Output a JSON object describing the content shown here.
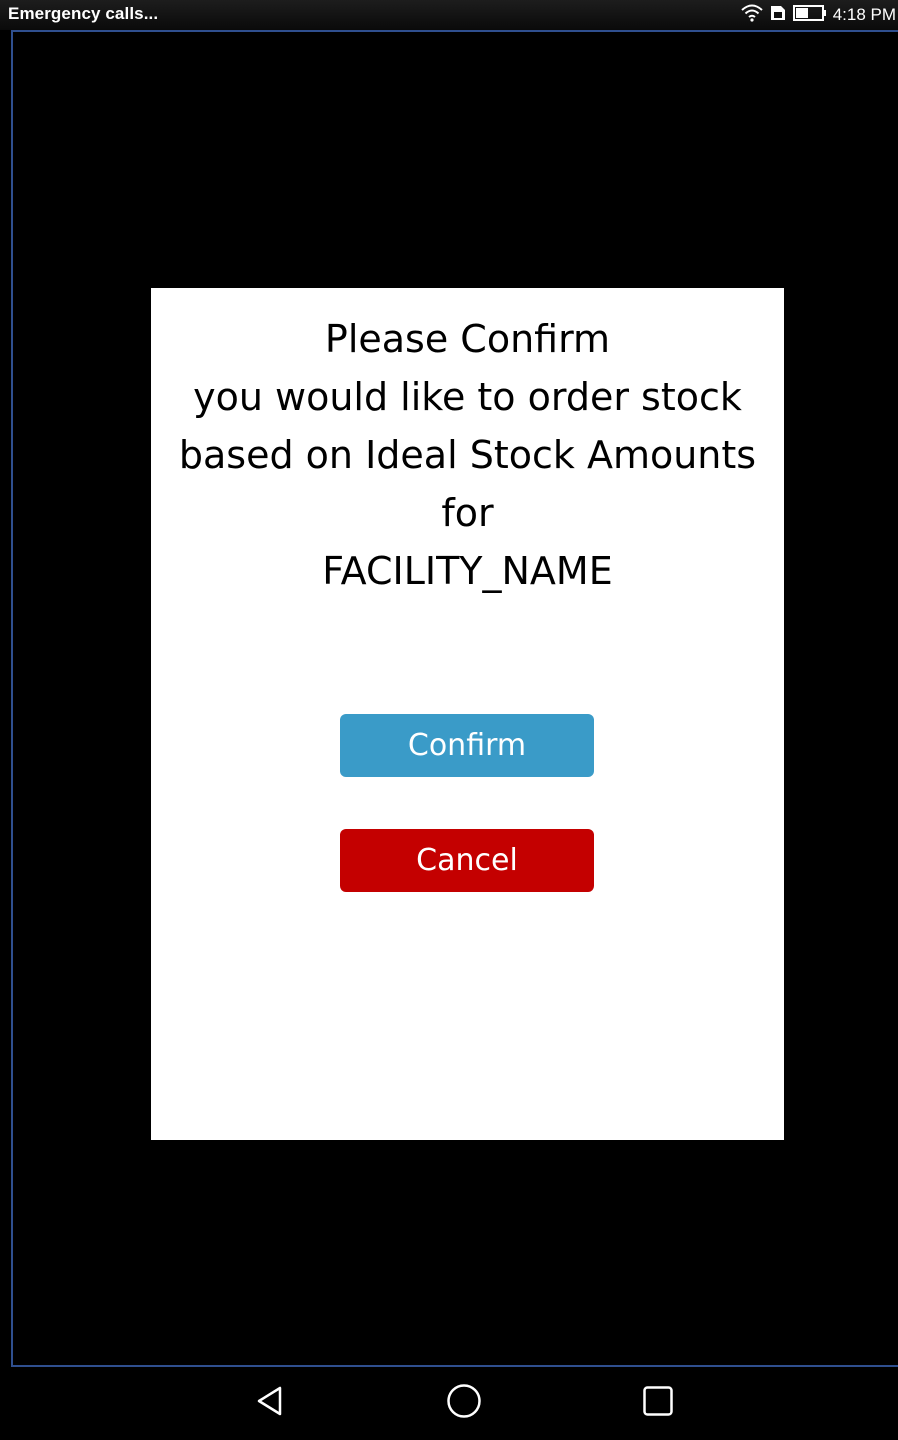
{
  "status_bar": {
    "carrier_text": "Emergency calls...",
    "time": "4:18 PM",
    "icons": [
      "wifi-icon",
      "sim-icon",
      "battery-icon"
    ]
  },
  "dialog": {
    "message_lines": [
      "Please Confirm",
      "you would like to order stock",
      "based on Ideal Stock Amounts",
      "for",
      "FACILITY_NAME"
    ],
    "confirm_label": "Confirm",
    "cancel_label": "Cancel"
  },
  "nav_bar": {
    "icons": [
      "back-icon",
      "home-icon",
      "recents-icon"
    ]
  },
  "colors": {
    "confirm_button": "#3a9bc8",
    "cancel_button": "#c40000",
    "dialog_background": "#ffffff",
    "screen_background": "#000000"
  }
}
